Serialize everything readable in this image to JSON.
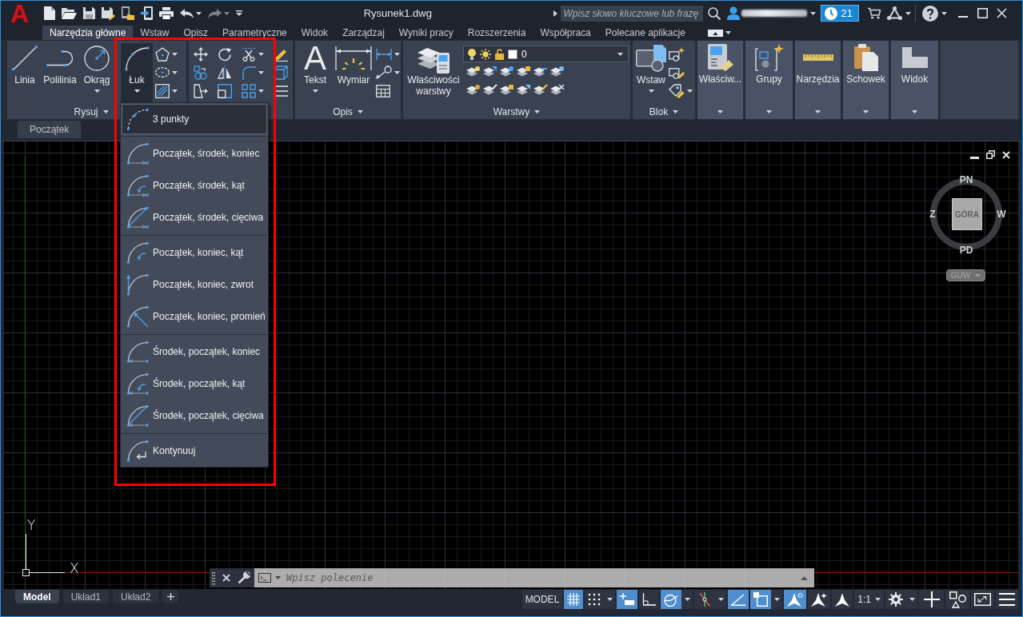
{
  "app_logo": "A",
  "window": {
    "title": "Rysunek1.dwg"
  },
  "quick_access": [
    {
      "kind": "new",
      "disabled": false
    },
    {
      "kind": "open",
      "disabled": false
    },
    {
      "kind": "save",
      "disabled": false
    },
    {
      "kind": "saveas",
      "disabled": false
    },
    {
      "kind": "webopen",
      "disabled": false
    },
    {
      "kind": "share",
      "disabled": false
    },
    {
      "kind": "print",
      "disabled": false
    },
    {
      "kind": "undo",
      "disabled": false
    },
    {
      "kind": "redo",
      "disabled": true
    }
  ],
  "search": {
    "placeholder": "Wpisz słowo kluczowe lub frazę"
  },
  "notifications": {
    "count": "21"
  },
  "ribbon_tabs": [
    {
      "label": "Narzędzia główne",
      "selected": true
    },
    {
      "label": "Wstaw",
      "selected": false
    },
    {
      "label": "Opisz",
      "selected": false
    },
    {
      "label": "Parametryczne",
      "selected": false
    },
    {
      "label": "Widok",
      "selected": false
    },
    {
      "label": "Zarządzaj",
      "selected": false
    },
    {
      "label": "Wyniki pracy",
      "selected": false
    },
    {
      "label": "Rozszerzenia",
      "selected": false
    },
    {
      "label": "Współpraca",
      "selected": false
    },
    {
      "label": "Polecane aplikacje",
      "selected": false
    }
  ],
  "ribbon_panels": [
    {
      "kind": "draw",
      "title": "Rysuj",
      "tools": [
        {
          "kind": "line",
          "label": "Linia",
          "dropdown": false,
          "expanded": false
        },
        {
          "kind": "polyline",
          "label": "Polilinia",
          "dropdown": false,
          "expanded": false
        },
        {
          "kind": "circle",
          "label": "Okrąg",
          "dropdown": true,
          "expanded": false
        },
        {
          "kind": "arc",
          "label": "Łuk",
          "dropdown": true,
          "expanded": true
        }
      ]
    },
    {
      "kind": "modify"
    },
    {
      "kind": "annotation",
      "title": "Opis",
      "tools": [
        {
          "kind": "text",
          "glyph": "A",
          "label": "Tekst",
          "dropdown": true,
          "expanded": false
        },
        {
          "kind": "dimension",
          "label": "Wymiar",
          "dropdown": false,
          "expanded": false
        }
      ]
    },
    {
      "kind": "layers",
      "title": "Warstwy",
      "current_layer": "0",
      "tools": [
        {
          "kind": "layerprops",
          "label": "Właściwości warstwy",
          "dropdown": false,
          "expanded": false
        }
      ]
    },
    {
      "kind": "block",
      "title": "Blok",
      "tools": [
        {
          "kind": "insert",
          "label": "Wstaw",
          "dropdown": true,
          "expanded": false
        }
      ]
    }
  ],
  "collapsed_panels": [
    {
      "kind": "properties",
      "label": "Właściw..."
    },
    {
      "kind": "groups",
      "label": "Grupy"
    },
    {
      "kind": "utilities",
      "label": "Narzędzia"
    },
    {
      "kind": "clipboard",
      "label": "Schowek"
    },
    {
      "kind": "view",
      "label": "Widok"
    }
  ],
  "file_tabs": [
    {
      "label": "Początek"
    }
  ],
  "arc_menu": {
    "groups": [
      {
        "items": [
          {
            "kind": "threepoint",
            "label": "3 punkty",
            "selected": true
          }
        ]
      },
      {
        "items": [
          {
            "kind": "sce",
            "label": "Początek, środek, koniec",
            "selected": false
          },
          {
            "kind": "sca",
            "label": "Początek, środek, kąt",
            "selected": false
          },
          {
            "kind": "scl",
            "label": "Początek, środek, cięciwa",
            "selected": false
          }
        ]
      },
      {
        "items": [
          {
            "kind": "sea",
            "label": "Początek, koniec, kąt",
            "selected": false
          },
          {
            "kind": "sed",
            "label": "Początek, koniec, zwrot",
            "selected": false
          },
          {
            "kind": "ser",
            "label": "Początek, koniec, promień",
            "selected": false
          }
        ]
      },
      {
        "items": [
          {
            "kind": "cse",
            "label": "Środek, początek, koniec",
            "selected": false
          },
          {
            "kind": "csa",
            "label": "Środek, początek, kąt",
            "selected": false
          },
          {
            "kind": "csl",
            "label": "Środek, początek, cięciwa",
            "selected": false
          }
        ]
      },
      {
        "items": [
          {
            "kind": "cont",
            "label": "Kontynuuj",
            "selected": false
          }
        ]
      }
    ]
  },
  "viewcube": {
    "north": "PN",
    "south": "PD",
    "west": "Z",
    "east": "W",
    "face": "GÓRA",
    "ucs_menu": "GUW"
  },
  "ucs_icon": {
    "y_label": "Y",
    "x_label": "X"
  },
  "command_line": {
    "placeholder": "Wpisz polecenie"
  },
  "layout_tabs": [
    {
      "label": "Model",
      "selected": true
    },
    {
      "label": "Układ1",
      "selected": false
    },
    {
      "label": "Układ2",
      "selected": false
    }
  ],
  "status_bar": {
    "items": [
      {
        "kind": "space",
        "label": "MODEL",
        "on": false,
        "dropdown": false
      },
      {
        "kind": "grid",
        "on": true,
        "dropdown": false
      },
      {
        "kind": "snap",
        "on": false,
        "dropdown": true
      },
      {
        "kind": "infer",
        "on": true,
        "dropdown": false
      },
      {
        "kind": "ortho",
        "on": false,
        "dropdown": false
      },
      {
        "kind": "polar",
        "on": true,
        "dropdown": true
      },
      {
        "kind": "iso",
        "on": false,
        "dropdown": true
      },
      {
        "kind": "track",
        "on": true,
        "dropdown": false
      },
      {
        "kind": "osnap",
        "on": true,
        "dropdown": true
      },
      {
        "kind": "annovis",
        "on": true,
        "dropdown": false
      },
      {
        "kind": "autoscale",
        "on": false,
        "dropdown": false
      },
      {
        "kind": "annoscale",
        "on": false,
        "dropdown": false
      },
      {
        "kind": "scale",
        "label": "1:1",
        "on": false,
        "dropdown": true
      },
      {
        "kind": "gear",
        "on": false,
        "dropdown": true
      },
      {
        "kind": "plus",
        "on": false,
        "dropdown": false
      },
      {
        "kind": "isolate",
        "on": false,
        "dropdown": false
      },
      {
        "kind": "fullscreen",
        "on": false,
        "dropdown": false
      },
      {
        "kind": "menu",
        "on": false,
        "dropdown": false
      }
    ]
  }
}
